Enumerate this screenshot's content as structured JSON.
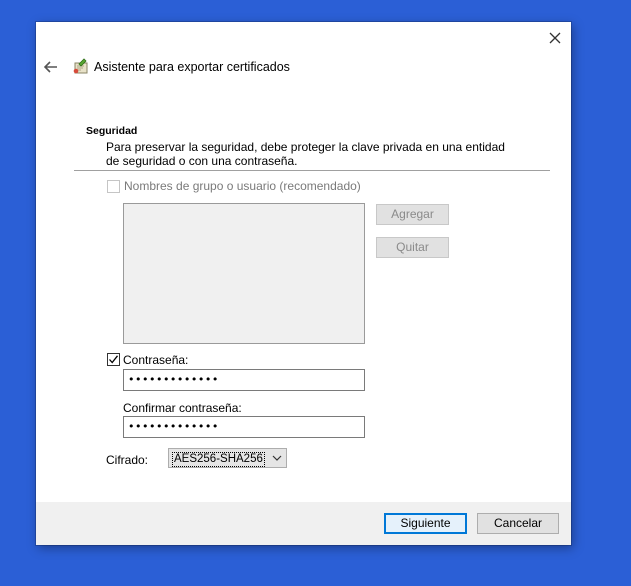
{
  "wizard": {
    "title": "Asistente para exportar certificados",
    "icons": {
      "back": "back-arrow-icon",
      "close": "close-icon",
      "app": "certificate-wizard-icon"
    }
  },
  "security": {
    "title": "Seguridad",
    "description": "Para preservar la seguridad, debe proteger la clave privada en una entidad de seguridad o con una contraseña.",
    "group_checkbox_label": "Nombres de grupo o usuario (recomendado)",
    "group_checkbox_checked": false,
    "group_checkbox_enabled": false,
    "add_label": "Agregar",
    "remove_label": "Quitar",
    "password_checkbox_label": "Contraseña:",
    "password_checkbox_checked": true,
    "password_value": "•••••••••••••",
    "confirm_label": "Confirmar contraseña:",
    "confirm_value": "•••••••••••••",
    "cipher_label": "Cifrado:",
    "cipher_selected": "AES256-SHA256"
  },
  "footer": {
    "next_label": "Siguiente",
    "cancel_label": "Cancelar"
  },
  "colors": {
    "desktop": "#2b5fd6",
    "accent": "#0078d7"
  }
}
